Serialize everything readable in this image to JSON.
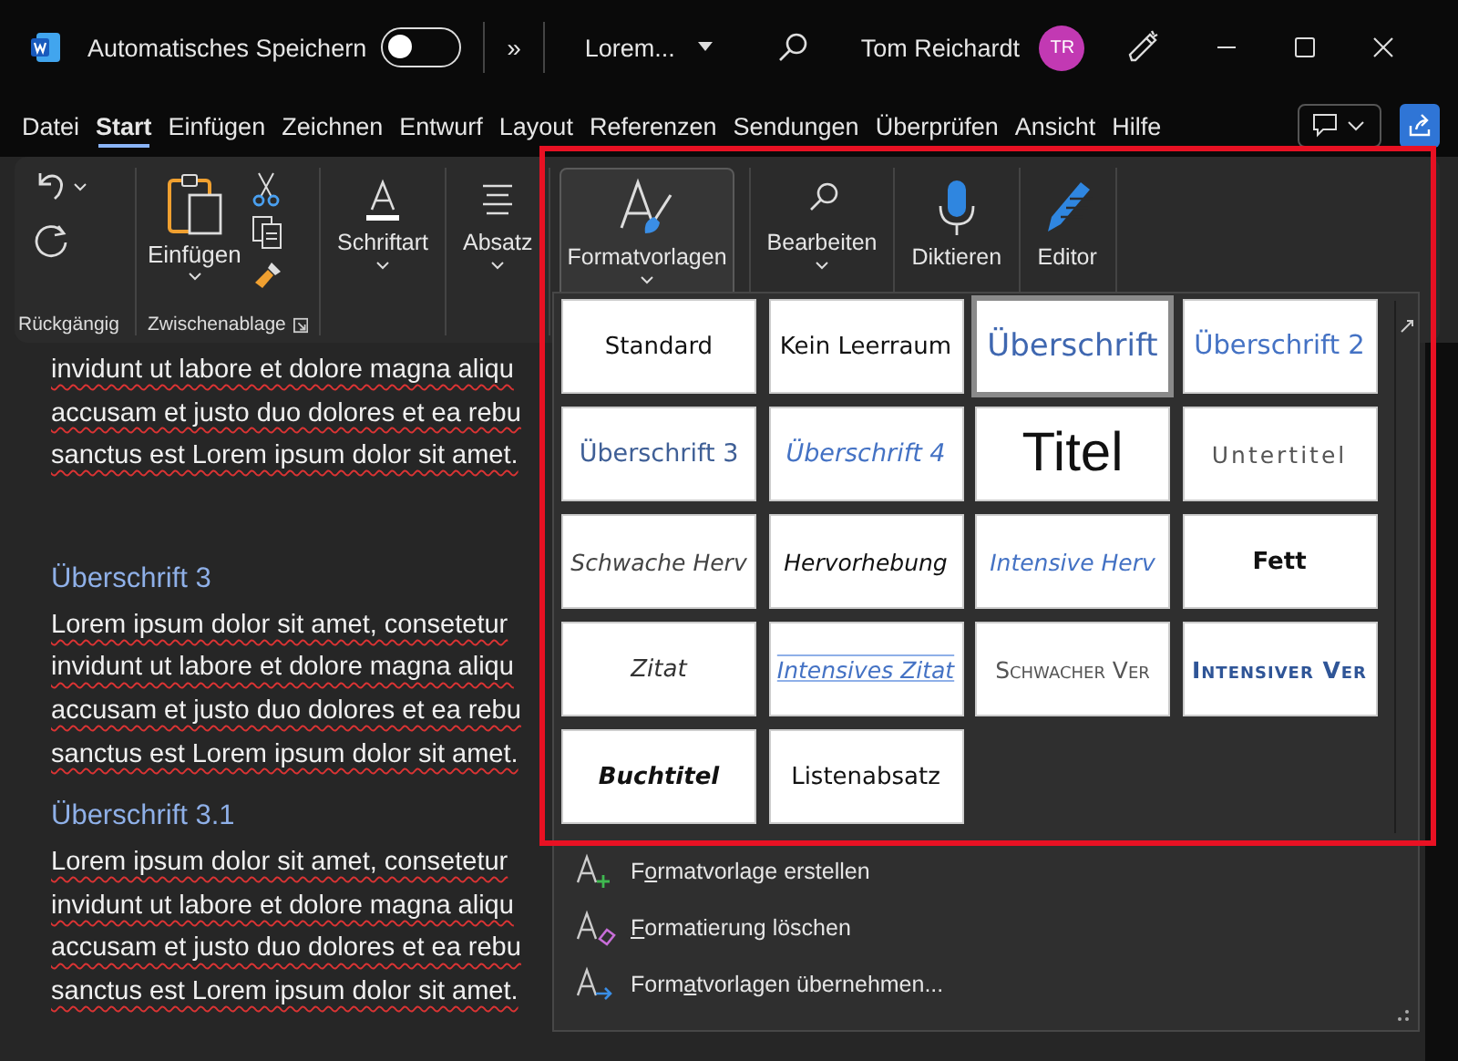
{
  "title_bar": {
    "autosave_label": "Automatisches Speichern",
    "autosave_on": false,
    "overflow": "»",
    "document_name": "Lorem...",
    "user_name": "Tom Reichardt",
    "user_initials": "TR"
  },
  "menu_tabs": [
    {
      "label": "Datei",
      "selected": false
    },
    {
      "label": "Start",
      "selected": true
    },
    {
      "label": "Einfügen",
      "selected": false
    },
    {
      "label": "Zeichnen",
      "selected": false
    },
    {
      "label": "Entwurf",
      "selected": false
    },
    {
      "label": "Layout",
      "selected": false
    },
    {
      "label": "Referenzen",
      "selected": false
    },
    {
      "label": "Sendungen",
      "selected": false
    },
    {
      "label": "Überprüfen",
      "selected": false
    },
    {
      "label": "Ansicht",
      "selected": false
    },
    {
      "label": "Hilfe",
      "selected": false
    }
  ],
  "ribbon": {
    "undo_group": {
      "label": "Rückgängig"
    },
    "clipboard_group": {
      "label": "Zwischenablage",
      "paste_label": "Einfügen"
    },
    "commands": [
      {
        "kind": "font",
        "label": "Schriftart",
        "selected": false
      },
      {
        "kind": "paragraph",
        "label": "Absatz",
        "selected": false
      },
      {
        "kind": "styles",
        "label": "Formatvorlagen",
        "selected": true
      },
      {
        "kind": "editing",
        "label": "Bearbeiten",
        "selected": false
      },
      {
        "kind": "dictate",
        "label": "Diktieren",
        "selected": false
      },
      {
        "kind": "editor",
        "label": "Editor",
        "selected": false
      }
    ]
  },
  "document": {
    "paragraphs": [
      {
        "kind": "body",
        "misspelled": true,
        "lines": [
          "invidunt ut labore et dolore magna aliqu",
          "accusam et justo duo dolores et ea rebu",
          "sanctus est Lorem ipsum dolor sit amet."
        ]
      },
      {
        "kind": "empty"
      },
      {
        "kind": "heading",
        "text": "Überschrift 3"
      },
      {
        "kind": "body",
        "misspelled": true,
        "lines": [
          "Lorem ipsum dolor sit amet, consetetur",
          "invidunt ut labore et dolore magna aliqu",
          "accusam et justo duo dolores et ea rebu",
          "sanctus est Lorem ipsum dolor sit amet."
        ]
      },
      {
        "kind": "heading",
        "text": "Überschrift 3.1"
      },
      {
        "kind": "body",
        "misspelled": true,
        "lines": [
          "Lorem ipsum dolor sit amet, consetetur",
          "invidunt ut labore et dolore magna aliqu",
          "accusam et justo duo dolores et ea rebu",
          "sanctus est Lorem ipsum dolor sit amet."
        ]
      }
    ]
  },
  "styles_gallery": {
    "styles": [
      {
        "label": "Standard",
        "kind": "normal",
        "selected": false
      },
      {
        "label": "Kein Leerraum",
        "kind": "no-spacing",
        "selected": false
      },
      {
        "label": "Überschrift",
        "kind": "heading1",
        "selected": true
      },
      {
        "label": "Überschrift 2",
        "kind": "heading2",
        "selected": false
      },
      {
        "label": "Überschrift 3",
        "kind": "heading3",
        "selected": false
      },
      {
        "label": "Überschrift 4",
        "kind": "heading4",
        "selected": false
      },
      {
        "label": "Titel",
        "kind": "title",
        "selected": false
      },
      {
        "label": "Untertitel",
        "kind": "subtitle",
        "selected": false
      },
      {
        "label": "Schwache Herv",
        "kind": "subtle-emphasis",
        "selected": false
      },
      {
        "label": "Hervorhebung",
        "kind": "emphasis",
        "selected": false
      },
      {
        "label": "Intensive Herv",
        "kind": "intense-emphasis",
        "selected": false
      },
      {
        "label": "Fett",
        "kind": "strong",
        "selected": false
      },
      {
        "label": "Zitat",
        "kind": "quote",
        "selected": false
      },
      {
        "label": "Intensives Zitat",
        "kind": "intense-quote",
        "selected": false
      },
      {
        "label": "Schwacher Ver",
        "kind": "subtle-reference",
        "selected": false
      },
      {
        "label": "Intensiver Ver",
        "kind": "intense-reference",
        "selected": false
      },
      {
        "label": "Buchtitel",
        "kind": "book-title",
        "selected": false
      },
      {
        "label": "Listenabsatz",
        "kind": "list-paragraph",
        "selected": false
      }
    ],
    "actions": [
      {
        "kind": "create",
        "before": "F",
        "key": "o",
        "after": "rmatvorlage erstellen"
      },
      {
        "kind": "clear",
        "key": "F",
        "after": "ormatierung löschen"
      },
      {
        "kind": "apply",
        "before": "Form",
        "key": "a",
        "after": "tvorlagen übernehmen..."
      }
    ]
  }
}
